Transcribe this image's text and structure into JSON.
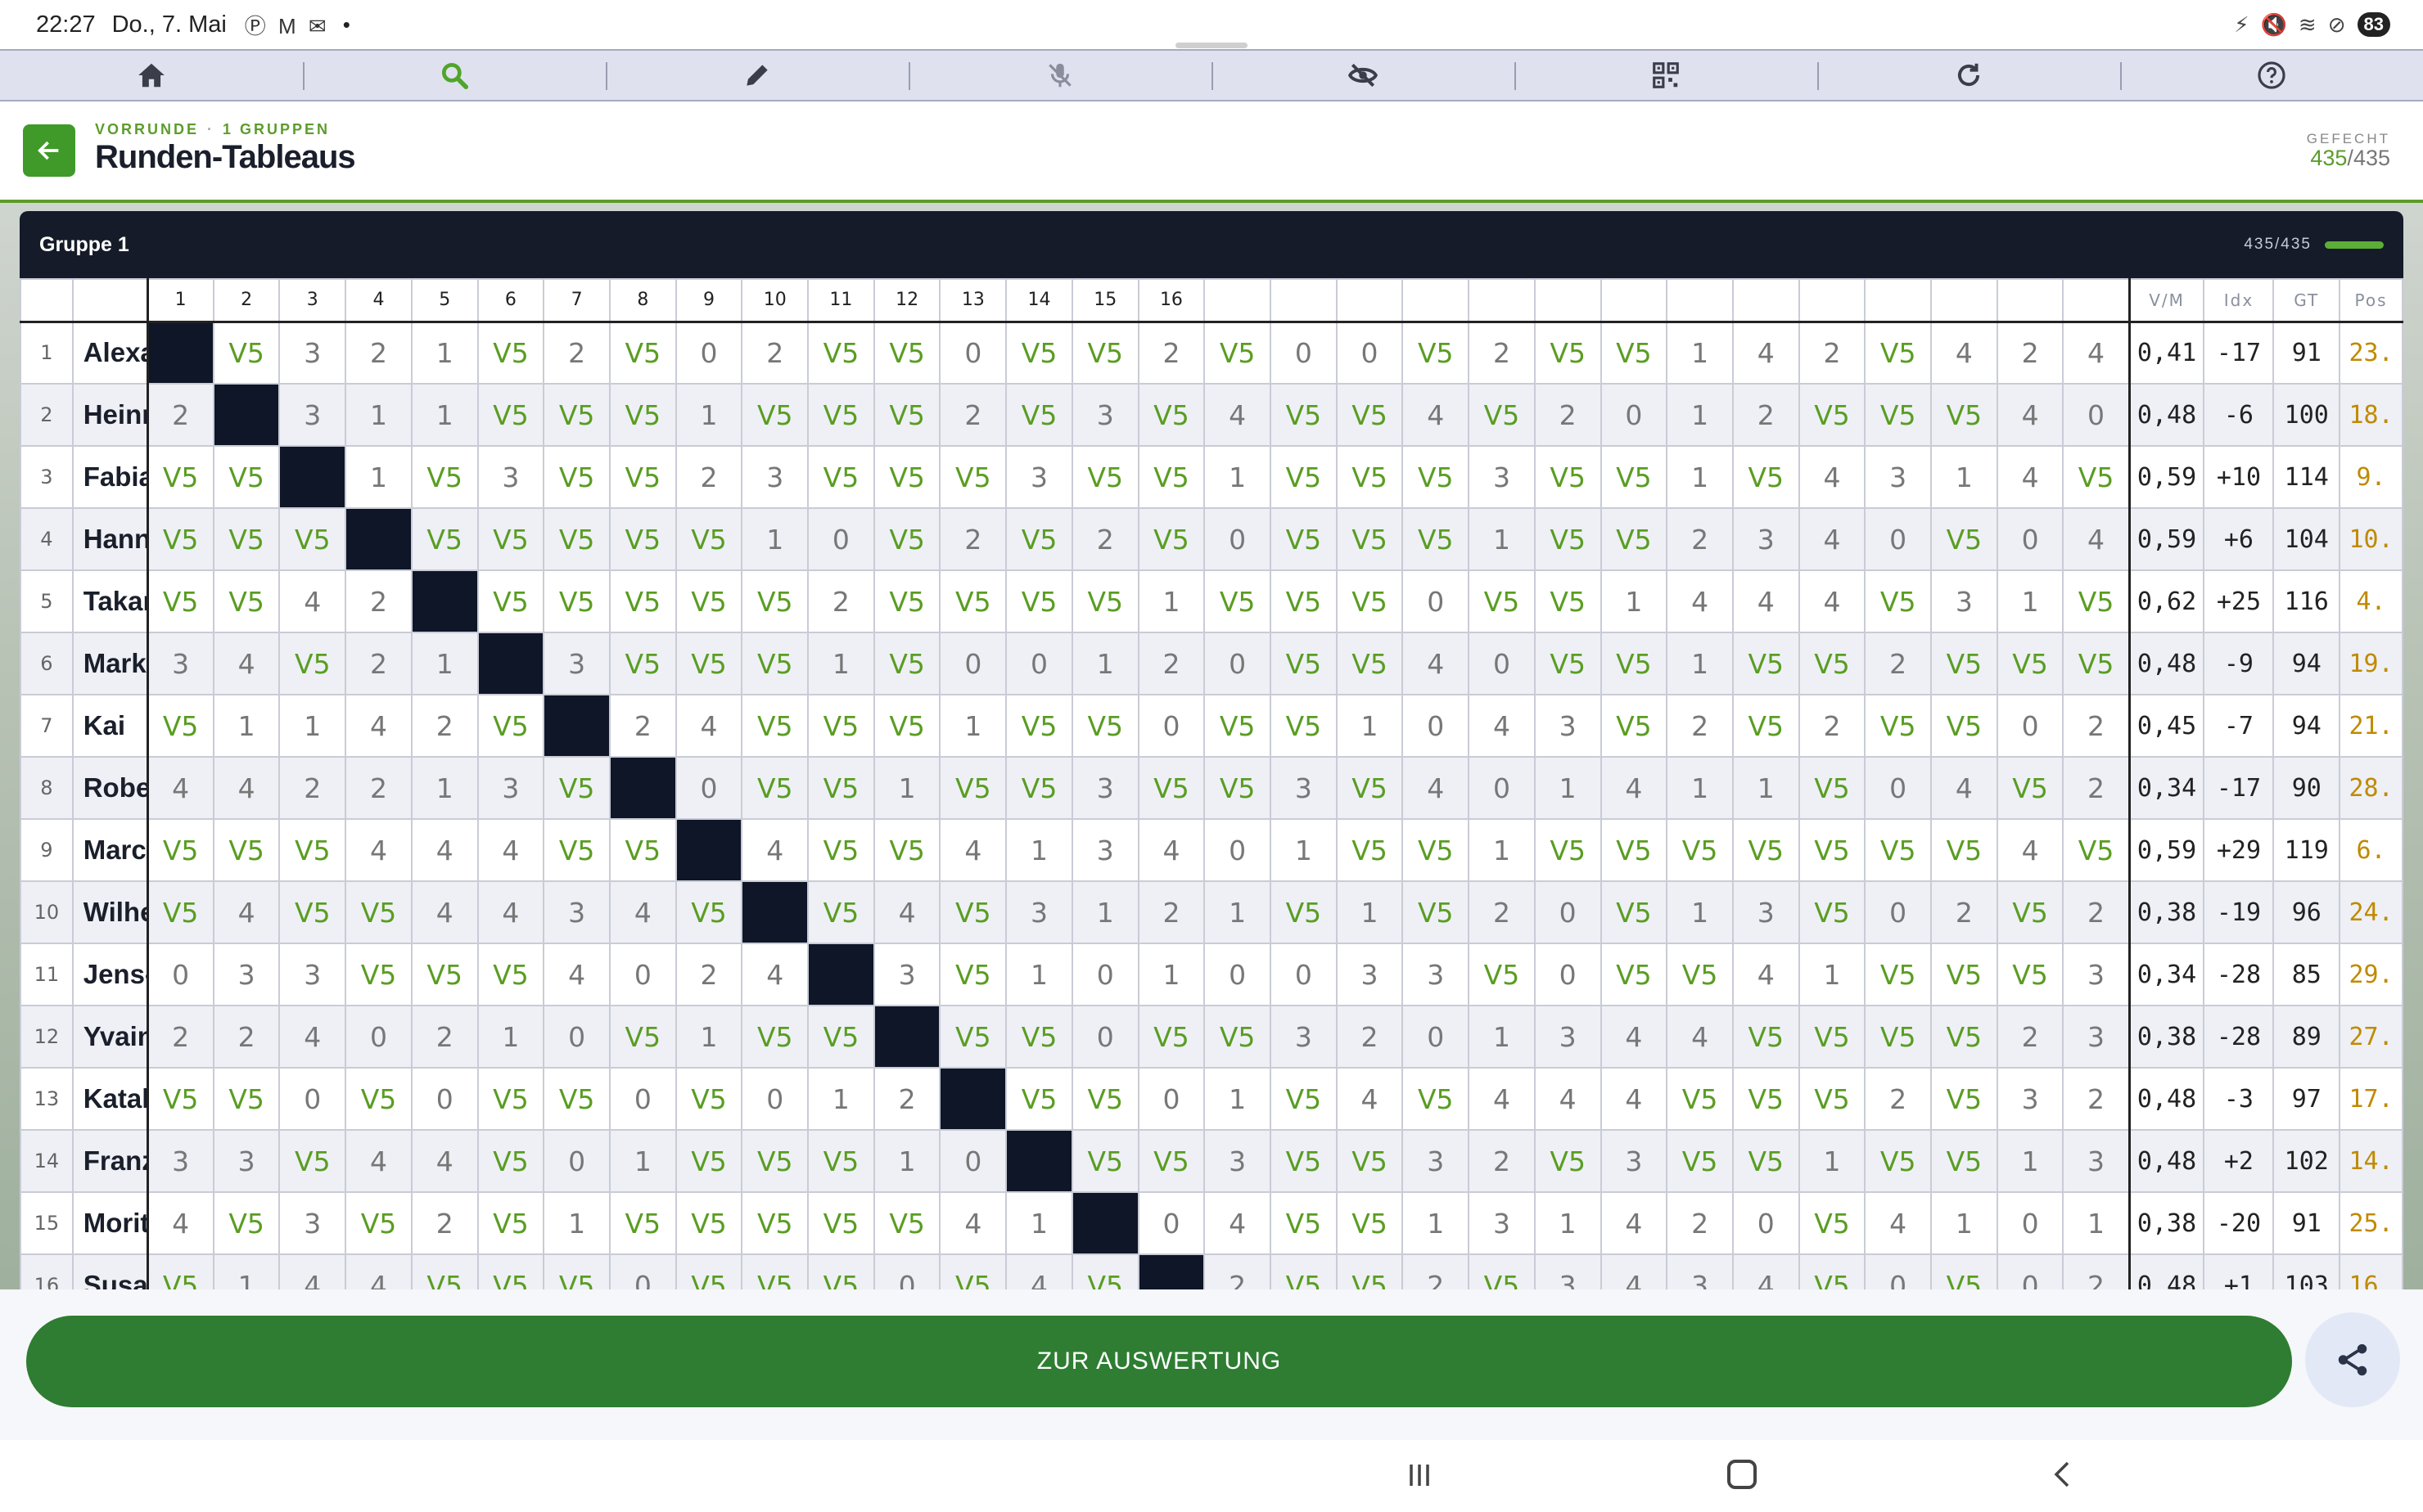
{
  "status_bar": {
    "time": "22:27",
    "date": "Do., 7. Mai",
    "notif_icons": "Ⓟ M ✉",
    "dot": "•",
    "battery": "83"
  },
  "toolbar": {
    "items": [
      "home-icon",
      "search-icon",
      "pencil-icon",
      "mic-off-icon",
      "eye-off-icon",
      "qr-code-icon",
      "refresh-icon",
      "help-icon"
    ]
  },
  "header": {
    "breadcrumb_round": "VORRUNDE",
    "breadcrumb_sep": "·",
    "breadcrumb_groups": "1 GRUPPEN",
    "title": "Runden-Tableaus",
    "bout_label": "GEFECHT",
    "bout_done": "435",
    "bout_sep": "/",
    "bout_total": "435"
  },
  "group": {
    "title": "Gruppe 1",
    "progress_text": "435/435",
    "progress_fraction": 1.0
  },
  "table": {
    "stat_headers": [
      "V/M",
      "Idx",
      "GT",
      "Pos"
    ],
    "rows": [
      {
        "no": "1",
        "name": "Alexander",
        "cells": [
          "■",
          "V5",
          "3",
          "2",
          "1",
          "V5",
          "2",
          "V5",
          "0",
          "2",
          "V5",
          "V5",
          "0",
          "V5",
          "V5",
          "2",
          "V5",
          "0",
          "0",
          "V5",
          "2",
          "V5",
          "V5",
          "1",
          "4",
          "2",
          "V5",
          "4",
          "2",
          "4"
        ],
        "vm": "0,41",
        "idx": "-17",
        "gt": "91",
        "pos": "23."
      },
      {
        "no": "2",
        "name": "Heinrich",
        "cells": [
          "2",
          "■",
          "3",
          "1",
          "1",
          "V5",
          "V5",
          "V5",
          "1",
          "V5",
          "V5",
          "V5",
          "2",
          "V5",
          "3",
          "V5",
          "4",
          "V5",
          "V5",
          "4",
          "V5",
          "2",
          "0",
          "1",
          "2",
          "V5",
          "V5",
          "V5",
          "4",
          "0"
        ],
        "vm": "0,48",
        "idx": "-6",
        "gt": "100",
        "pos": "18."
      },
      {
        "no": "3",
        "name": "Fabiana",
        "cells": [
          "V5",
          "V5",
          "■",
          "1",
          "V5",
          "3",
          "V5",
          "V5",
          "2",
          "3",
          "V5",
          "V5",
          "V5",
          "3",
          "V5",
          "V5",
          "1",
          "V5",
          "V5",
          "V5",
          "3",
          "V5",
          "V5",
          "1",
          "V5",
          "4",
          "3",
          "1",
          "4",
          "V5"
        ],
        "vm": "0,59",
        "idx": "+10",
        "gt": "114",
        "pos": "9."
      },
      {
        "no": "4",
        "name": "Hannes",
        "cells": [
          "V5",
          "V5",
          "V5",
          "■",
          "V5",
          "V5",
          "V5",
          "V5",
          "V5",
          "1",
          "0",
          "V5",
          "2",
          "V5",
          "2",
          "V5",
          "0",
          "V5",
          "V5",
          "V5",
          "1",
          "V5",
          "V5",
          "2",
          "3",
          "4",
          "0",
          "V5",
          "0",
          "4"
        ],
        "vm": "0,59",
        "idx": "+6",
        "gt": "104",
        "pos": "10."
      },
      {
        "no": "5",
        "name": "Takamitsu",
        "cells": [
          "V5",
          "V5",
          "4",
          "2",
          "■",
          "V5",
          "V5",
          "V5",
          "V5",
          "V5",
          "2",
          "V5",
          "V5",
          "V5",
          "V5",
          "1",
          "V5",
          "V5",
          "V5",
          "0",
          "V5",
          "V5",
          "1",
          "4",
          "4",
          "4",
          "V5",
          "3",
          "1",
          "V5"
        ],
        "vm": "0,62",
        "idx": "+25",
        "gt": "116",
        "pos": "4."
      },
      {
        "no": "6",
        "name": "Markus",
        "cells": [
          "3",
          "4",
          "V5",
          "2",
          "1",
          "■",
          "3",
          "V5",
          "V5",
          "V5",
          "1",
          "V5",
          "0",
          "0",
          "1",
          "2",
          "0",
          "V5",
          "V5",
          "4",
          "0",
          "V5",
          "V5",
          "1",
          "V5",
          "V5",
          "2",
          "V5",
          "V5",
          "V5"
        ],
        "vm": "0,48",
        "idx": "-9",
        "gt": "94",
        "pos": "19."
      },
      {
        "no": "7",
        "name": "Kai",
        "cells": [
          "V5",
          "1",
          "1",
          "4",
          "2",
          "V5",
          "■",
          "2",
          "4",
          "V5",
          "V5",
          "V5",
          "1",
          "V5",
          "V5",
          "0",
          "V5",
          "V5",
          "1",
          "0",
          "4",
          "3",
          "V5",
          "2",
          "V5",
          "2",
          "V5",
          "V5",
          "0",
          "2"
        ],
        "vm": "0,45",
        "idx": "-7",
        "gt": "94",
        "pos": "21."
      },
      {
        "no": "8",
        "name": "Robert",
        "cells": [
          "4",
          "4",
          "2",
          "2",
          "1",
          "3",
          "V5",
          "■",
          "0",
          "V5",
          "V5",
          "1",
          "V5",
          "V5",
          "3",
          "V5",
          "V5",
          "3",
          "V5",
          "4",
          "0",
          "1",
          "4",
          "1",
          "1",
          "V5",
          "0",
          "4",
          "V5",
          "2"
        ],
        "vm": "0,34",
        "idx": "-17",
        "gt": "90",
        "pos": "28."
      },
      {
        "no": "9",
        "name": "Marco",
        "cells": [
          "V5",
          "V5",
          "V5",
          "4",
          "4",
          "4",
          "V5",
          "V5",
          "■",
          "4",
          "V5",
          "V5",
          "4",
          "1",
          "3",
          "4",
          "0",
          "1",
          "V5",
          "V5",
          "1",
          "V5",
          "V5",
          "V5",
          "V5",
          "V5",
          "V5",
          "V5",
          "4",
          "V5"
        ],
        "vm": "0,59",
        "idx": "+29",
        "gt": "119",
        "pos": "6."
      },
      {
        "no": "10",
        "name": "Wilhelm",
        "cells": [
          "V5",
          "4",
          "V5",
          "V5",
          "4",
          "4",
          "3",
          "4",
          "V5",
          "■",
          "V5",
          "4",
          "V5",
          "3",
          "1",
          "2",
          "1",
          "V5",
          "1",
          "V5",
          "2",
          "0",
          "V5",
          "1",
          "3",
          "V5",
          "0",
          "2",
          "V5",
          "2"
        ],
        "vm": "0,38",
        "idx": "-19",
        "gt": "96",
        "pos": "24."
      },
      {
        "no": "11",
        "name": "Jens-Uwe",
        "cells": [
          "0",
          "3",
          "3",
          "V5",
          "V5",
          "V5",
          "4",
          "0",
          "2",
          "4",
          "■",
          "3",
          "V5",
          "1",
          "0",
          "1",
          "0",
          "0",
          "3",
          "3",
          "V5",
          "0",
          "V5",
          "V5",
          "4",
          "1",
          "V5",
          "V5",
          "V5",
          "3"
        ],
        "vm": "0,34",
        "idx": "-28",
        "gt": "85",
        "pos": "29."
      },
      {
        "no": "12",
        "name": "Yvaine-Fay",
        "cells": [
          "2",
          "2",
          "4",
          "0",
          "2",
          "1",
          "0",
          "V5",
          "1",
          "V5",
          "V5",
          "■",
          "V5",
          "V5",
          "0",
          "V5",
          "V5",
          "3",
          "2",
          "0",
          "1",
          "3",
          "4",
          "4",
          "V5",
          "V5",
          "V5",
          "V5",
          "2",
          "3"
        ],
        "vm": "0,38",
        "idx": "-28",
        "gt": "89",
        "pos": "27."
      },
      {
        "no": "13",
        "name": "Katalina",
        "cells": [
          "V5",
          "V5",
          "0",
          "V5",
          "0",
          "V5",
          "V5",
          "0",
          "V5",
          "0",
          "1",
          "2",
          "■",
          "V5",
          "V5",
          "0",
          "1",
          "V5",
          "4",
          "V5",
          "4",
          "4",
          "4",
          "V5",
          "V5",
          "V5",
          "2",
          "V5",
          "3",
          "2"
        ],
        "vm": "0,48",
        "idx": "-3",
        "gt": "97",
        "pos": "17."
      },
      {
        "no": "14",
        "name": "Franz",
        "cells": [
          "3",
          "3",
          "V5",
          "4",
          "4",
          "V5",
          "0",
          "1",
          "V5",
          "V5",
          "V5",
          "1",
          "0",
          "■",
          "V5",
          "V5",
          "3",
          "V5",
          "V5",
          "3",
          "2",
          "V5",
          "3",
          "V5",
          "V5",
          "1",
          "V5",
          "V5",
          "1",
          "3"
        ],
        "vm": "0,48",
        "idx": "+2",
        "gt": "102",
        "pos": "14."
      },
      {
        "no": "15",
        "name": "Moritz",
        "cells": [
          "4",
          "V5",
          "3",
          "V5",
          "2",
          "V5",
          "1",
          "V5",
          "V5",
          "V5",
          "V5",
          "V5",
          "4",
          "1",
          "■",
          "0",
          "4",
          "V5",
          "V5",
          "1",
          "3",
          "1",
          "4",
          "2",
          "0",
          "V5",
          "4",
          "1",
          "0",
          "1"
        ],
        "vm": "0,38",
        "idx": "-20",
        "gt": "91",
        "pos": "25."
      },
      {
        "no": "16",
        "name": "Susanne",
        "cells": [
          "V5",
          "1",
          "4",
          "4",
          "V5",
          "V5",
          "V5",
          "0",
          "V5",
          "V5",
          "V5",
          "0",
          "V5",
          "4",
          "V5",
          "■",
          "2",
          "V5",
          "V5",
          "2",
          "V5",
          "3",
          "4",
          "3",
          "4",
          "V5",
          "0",
          "V5",
          "0",
          "2"
        ],
        "vm": "0,48",
        "idx": "+1",
        "gt": "103",
        "pos": "16."
      }
    ]
  },
  "bottom": {
    "eval_label": "ZUR AUSWERTUNG",
    "share_icon": "share-icon"
  },
  "navbar": {
    "items": [
      "recents-icon",
      "home-circle-icon",
      "back-arrow-icon"
    ]
  },
  "colors": {
    "accent_green": "#5a9d22",
    "button_green": "#2e7d32",
    "panel_dark": "#151b28",
    "self_cell": "#0e1628",
    "pos_gold": "#c08a00"
  }
}
